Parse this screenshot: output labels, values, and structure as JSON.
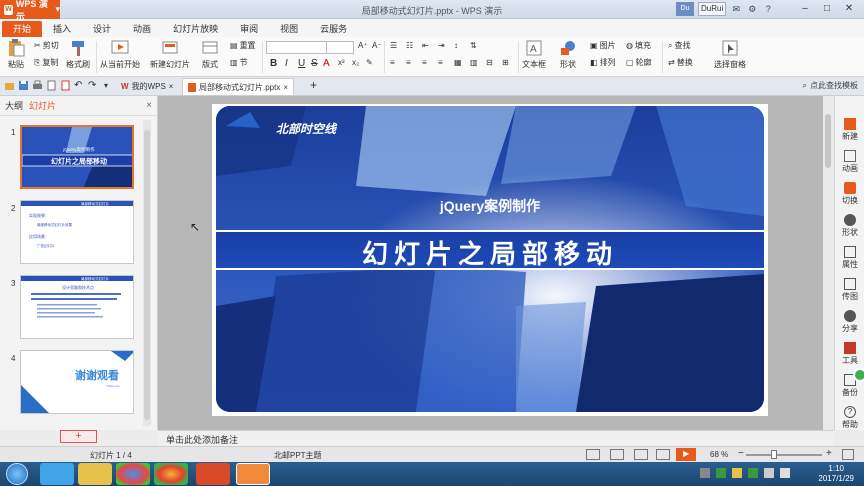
{
  "window": {
    "app_menu_label": "WPS 演示",
    "doc_title": "局部移动式幻灯片.pptx - WPS 演示",
    "user_avatar": "Du",
    "user_name": "DuRui"
  },
  "tabs": [
    "开始",
    "插入",
    "设计",
    "动画",
    "幻灯片放映",
    "审阅",
    "视图",
    "云服务"
  ],
  "ribbon": {
    "paste": "粘贴",
    "cut": "剪切",
    "copy": "复制",
    "format_painter": "格式刷",
    "from_current": "从当前开始",
    "new_slide": "新建幻灯片",
    "layout": "版式",
    "reset": "重置",
    "section": "节",
    "textbox": "文本框",
    "shape": "形状",
    "picture": "图片",
    "fill": "填充",
    "arrange": "排列",
    "outline": "轮廓",
    "find": "查找",
    "replace": "替换",
    "select_pane": "选择窗格",
    "format_buttons": [
      "B",
      "I",
      "U",
      "S",
      "A"
    ]
  },
  "doc_tabs": {
    "home_tab": "我的WPS",
    "active_tab": "局部移动式幻灯片.pptx",
    "search_template": "点此查找模板"
  },
  "left_panel": {
    "tab_outline": "大纲",
    "tab_slides": "幻灯片",
    "thumb_numbers": [
      "1",
      "2",
      "3",
      "4"
    ],
    "thumb1_subtitle": "jQuery案例制作",
    "thumb1_title": "幻灯片之局部移动",
    "thumb2_title": "局部移动式幻灯片",
    "thumb2_lines": [
      "实现效果：",
      "局部移动式幻灯片效果",
      "应用场景：",
      "广告幻灯片"
    ],
    "thumb3_title": "局部移动式幻灯片",
    "thumb3_heading": "设计思路和技术点",
    "thumb4_text": "谢谢观看",
    "thumb4_sub": "Thank you",
    "add_slide": "+"
  },
  "slide": {
    "logo_text": "北部时空线",
    "subtitle": "jQuery案例制作",
    "title": "幻灯片之局部移动"
  },
  "right_tools": [
    "新建",
    "动画",
    "切换",
    "形状",
    "属性",
    "传图",
    "分享",
    "工具",
    "备份",
    "帮助"
  ],
  "notes": {
    "placeholder": "单击此处添加备注"
  },
  "status": {
    "slide_counter": "幻灯片 1 / 4",
    "theme": "北邮PPT主题",
    "zoom": "68 %"
  },
  "taskbar": {
    "time": "1:10",
    "date": "2017/1/29"
  },
  "colors": {
    "accent": "#e85a1c",
    "slide_blue": "#1e4ab8"
  }
}
